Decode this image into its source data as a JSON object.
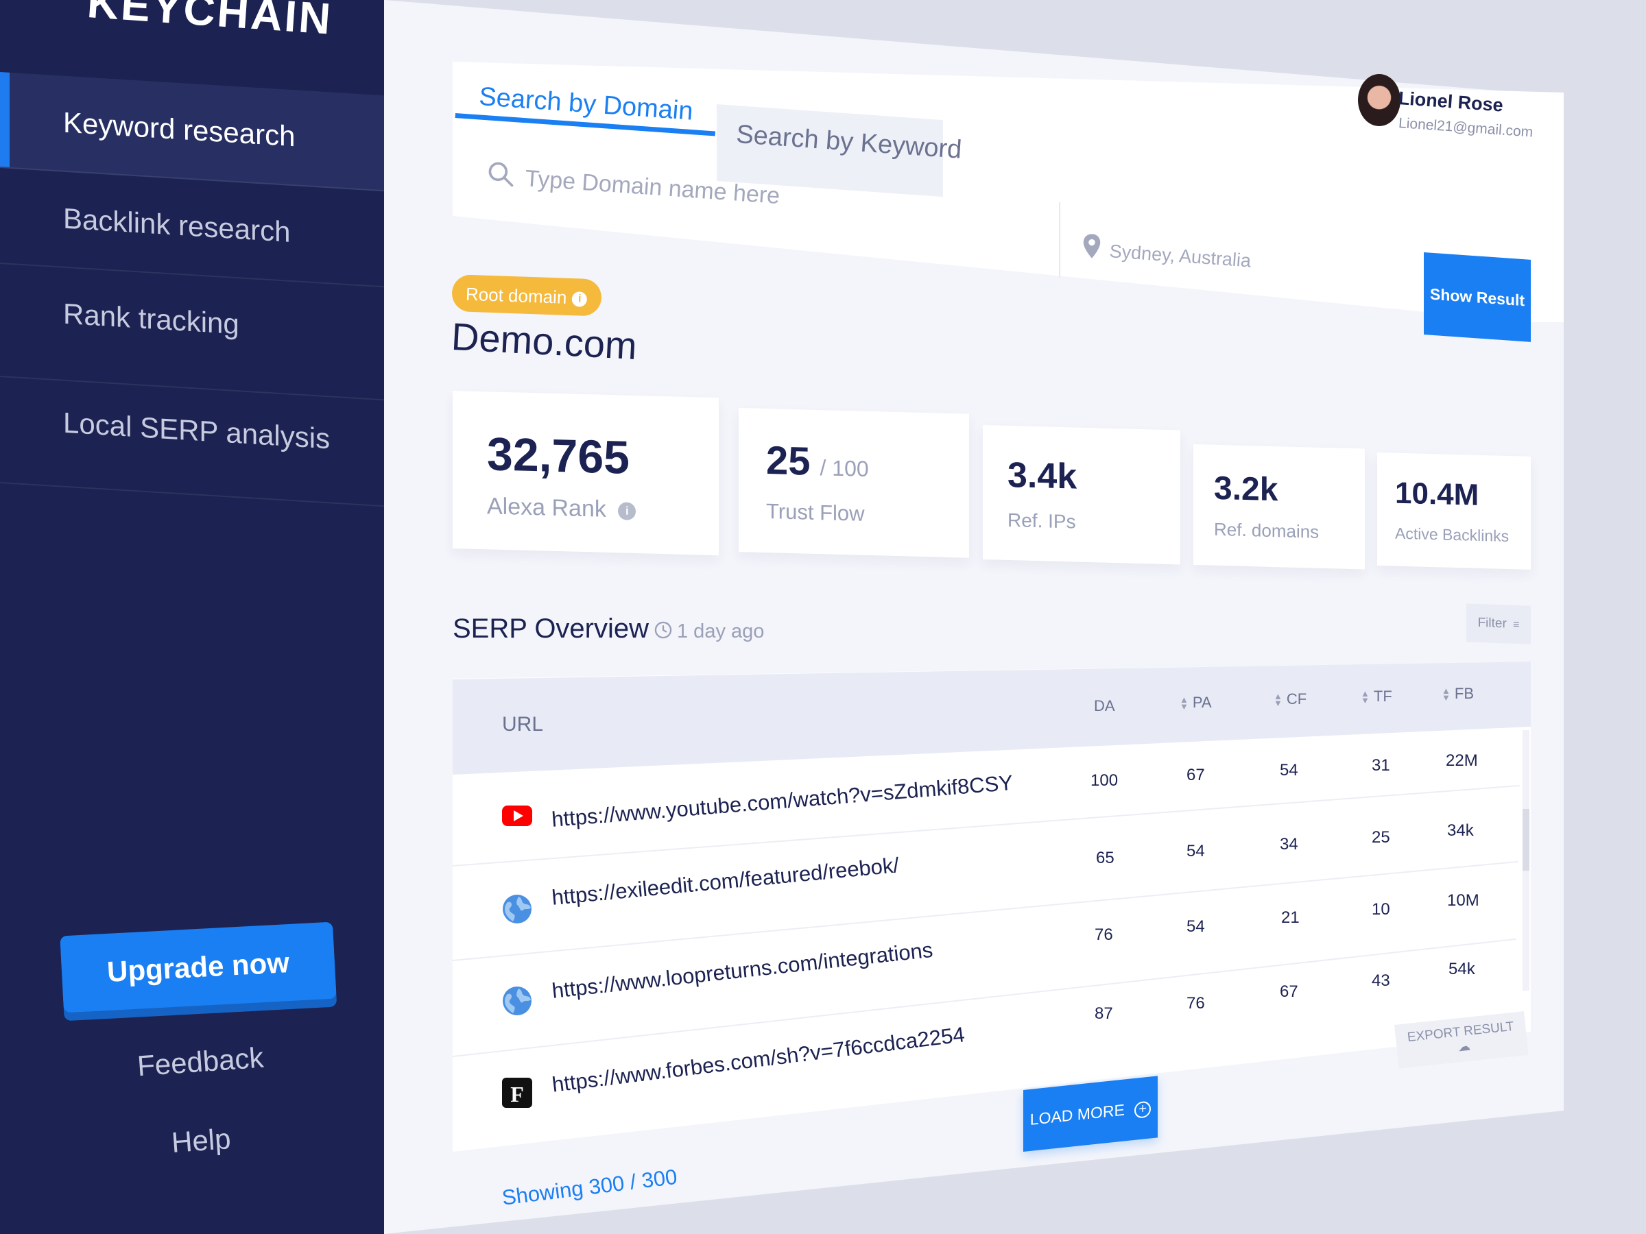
{
  "app": {
    "brand": "KEYCHAIN"
  },
  "sidebar": {
    "items": [
      {
        "label": "Keyword research",
        "active": true
      },
      {
        "label": "Backlink research",
        "active": false
      },
      {
        "label": "Rank tracking",
        "active": false
      },
      {
        "label": "Local SERP analysis",
        "active": false
      }
    ],
    "upgrade_label": "Upgrade now",
    "feedback_label": "Feedback",
    "help_label": "Help"
  },
  "search": {
    "tabs": [
      {
        "label": "Search by Domain",
        "active": true
      },
      {
        "label": "Search by Keyword",
        "active": false
      }
    ],
    "domain_placeholder": "Type Domain name here",
    "location_placeholder": "Sydney, Australia",
    "submit_label": "Show Result"
  },
  "user": {
    "name": "Lionel Rose",
    "email": "Lionel21@gmail.com"
  },
  "domain": {
    "badge": "Root domain",
    "badge_info": "i",
    "name": "Demo.com"
  },
  "stats": [
    {
      "value": "32,765",
      "suffix": "",
      "label": "Alexa Rank",
      "info": "i"
    },
    {
      "value": "25",
      "suffix": "/ 100",
      "label": "Trust Flow"
    },
    {
      "value": "3.4k",
      "suffix": "",
      "label": "Ref. IPs"
    },
    {
      "value": "3.2k",
      "suffix": "",
      "label": "Ref. domains"
    },
    {
      "value": "10.4M",
      "suffix": "",
      "label": "Active Backlinks"
    }
  ],
  "serp": {
    "title": "SERP Overview",
    "updated": "1 day ago",
    "filter_label": "Filter",
    "columns": [
      "URL",
      "DA",
      "PA",
      "CF",
      "TF",
      "FB"
    ],
    "rows": [
      {
        "icon": "youtube-icon",
        "url": "https://www.youtube.com/watch?v=sZdmkif8CSY",
        "da": "100",
        "pa": "67",
        "cf": "54",
        "tf": "31",
        "fb": "22M"
      },
      {
        "icon": "globe-icon",
        "url": "https://exileedit.com/featured/reebok/",
        "da": "65",
        "pa": "54",
        "cf": "34",
        "tf": "25",
        "fb": "34k"
      },
      {
        "icon": "globe-icon",
        "url": "https://www.loopreturns.com/integrations",
        "da": "76",
        "pa": "54",
        "cf": "21",
        "tf": "10",
        "fb": "10M"
      },
      {
        "icon": "forbes-icon",
        "url": "https://www.forbes.com/sh?v=7f6ccdca2254",
        "da": "87",
        "pa": "76",
        "cf": "67",
        "tf": "43",
        "fb": "54k"
      }
    ],
    "export_label": "EXPORT RESULT",
    "load_more_label": "LOAD MORE",
    "showing": "Showing 300 / 300"
  },
  "colors": {
    "sidebar_bg": "#1c2251",
    "accent": "#1a7ff2",
    "badge": "#f5b93c"
  }
}
